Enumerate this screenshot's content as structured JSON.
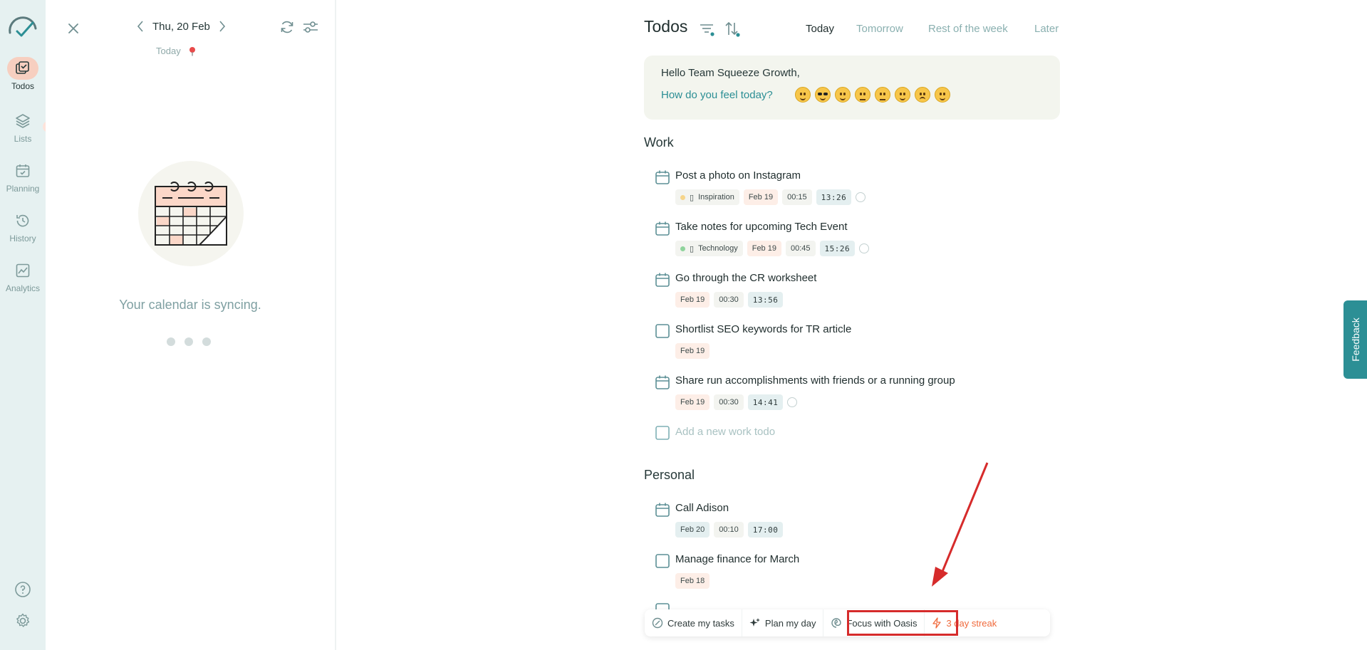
{
  "rail": {
    "items": [
      {
        "label": "Todos",
        "active": true
      },
      {
        "label": "Lists"
      },
      {
        "label": "Planning"
      },
      {
        "label": "History"
      },
      {
        "label": "Analytics"
      }
    ]
  },
  "calendar": {
    "date": "Thu, 20 Feb",
    "today": "Today",
    "sync_text": "Your calendar is syncing."
  },
  "header": {
    "title": "Todos",
    "tabs": [
      "Today",
      "Tomorrow",
      "Rest of the week",
      "Later"
    ],
    "active_tab": "Today"
  },
  "greeting": {
    "hello": "Hello Team Squeeze Growth,",
    "question": "How do you feel today?"
  },
  "work": {
    "title": "Work",
    "tasks": [
      {
        "title": "Post a photo on Instagram",
        "category": "Inspiration",
        "category_color": "#f6d58a",
        "date": "Feb 19",
        "duration": "00:15",
        "time": "13:26",
        "icon": "calendar-icon"
      },
      {
        "title": "Take notes for upcoming Tech Event",
        "category": "Technology",
        "category_color": "#8fd39c",
        "date": "Feb 19",
        "duration": "00:45",
        "time": "15:26",
        "icon": "calendar-icon"
      },
      {
        "title": "Go through the CR worksheet",
        "date": "Feb 19",
        "duration": "00:30",
        "time": "13:56",
        "icon": "calendar-icon"
      },
      {
        "title": "Shortlist SEO keywords for TR article",
        "date": "Feb 19",
        "icon": "checkbox-icon"
      },
      {
        "title": "Share run accomplishments with friends or a running group",
        "date": "Feb 19",
        "duration": "00:30",
        "time": "14:41",
        "icon": "calendar-icon"
      }
    ],
    "add_placeholder": "Add a new work todo"
  },
  "personal": {
    "title": "Personal",
    "tasks": [
      {
        "title": "Call Adison",
        "date": "Feb 20",
        "duration": "00:10",
        "time": "17:00",
        "icon": "calendar-icon"
      },
      {
        "title": "Manage finance for March",
        "date": "Feb 18",
        "icon": "checkbox-icon"
      }
    ]
  },
  "toolbar": {
    "create": "Create my tasks",
    "plan": "Plan my day",
    "focus": "Focus with Oasis",
    "streak": "3 day streak"
  },
  "feedback": "Feedback",
  "colors": {
    "accent": "#2c8f95",
    "rail_bg": "#e6f1f1",
    "active_pill": "#f7cfc0",
    "annotation": "#d62b2b",
    "streak": "#f06a3c"
  }
}
